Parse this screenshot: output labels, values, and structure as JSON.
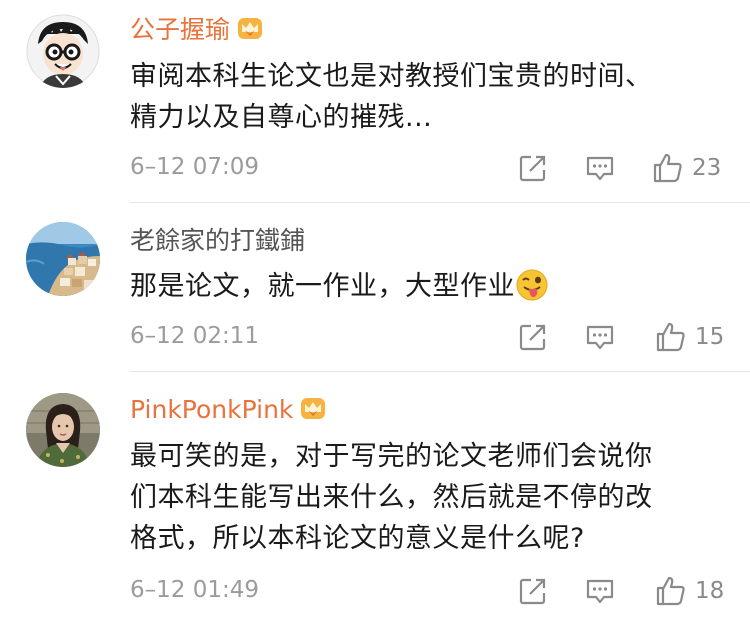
{
  "comments": [
    {
      "author": "公子握瑜",
      "vip": true,
      "text_lines": [
        "审阅本科生论文也是对教授们宝贵的时间、",
        "精力以及自尊心的摧残..."
      ],
      "time": "6–12 07:09",
      "likes": "23",
      "avatar_icon": "cartoon-glasses-avatar"
    },
    {
      "author": "老餘家的打鐵鋪",
      "vip": false,
      "text": "那是论文，就一作业，大型作业",
      "emoji": "tongue-wink-emoji",
      "time": "6–12 02:11",
      "likes": "15",
      "avatar_icon": "coastal-town-avatar"
    },
    {
      "author": "PinkPonkPink",
      "vip": true,
      "text_lines": [
        "最可笑的是，对于写完的论文老师们会说你",
        "们本科生能写出来什么，然后就是不停的改",
        "格式，所以本科论文的意义是什么呢?"
      ],
      "time": "6–12 01:49",
      "likes": "18",
      "avatar_icon": "person-photo-avatar"
    }
  ],
  "colors": {
    "vip_name": "#e8733d",
    "normal_name": "#555555",
    "meta": "#9b9b9b",
    "icon": "#8a8a8a"
  }
}
